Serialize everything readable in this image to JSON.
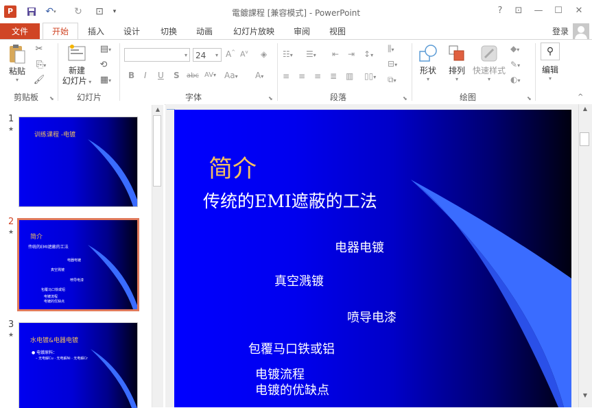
{
  "window": {
    "title": "電鍍課程 [兼容模式] - PowerPoint",
    "help_icon": "?",
    "colors": {
      "accent": "#d04525",
      "slide_blue": "#0000ff",
      "slide_title": "#f5c060"
    }
  },
  "tabs": {
    "file": "文件",
    "items": [
      "开始",
      "插入",
      "设计",
      "切换",
      "动画",
      "幻灯片放映",
      "审阅",
      "视图"
    ],
    "active": "开始",
    "signin": "登录"
  },
  "ribbon": {
    "clipboard": {
      "paste": "粘贴",
      "group": "剪贴板"
    },
    "slides": {
      "new_slide_line1": "新建",
      "new_slide_line2": "幻灯片",
      "group": "幻灯片"
    },
    "font": {
      "font_name": "",
      "font_size": "24",
      "group": "字体"
    },
    "paragraph": {
      "group": "段落"
    },
    "drawing": {
      "shape": "形状",
      "arrange": "排列",
      "quick_styles": "快速样式",
      "group": "绘图"
    },
    "editing": {
      "edit": "编辑"
    }
  },
  "slides": [
    {
      "number": "1",
      "title": "训练课程 -电镀",
      "lines": []
    },
    {
      "number": "2",
      "title": "简介",
      "lines": [
        "传统的EMI遮蔽的工法",
        "电器电镀",
        "真空溅镀",
        "喷导电漆",
        "包覆马口铁或铝",
        "电镀流程",
        "电镀的优缺点"
      ]
    },
    {
      "number": "3",
      "title": "水电镀&电器电镀",
      "lines": [
        "● 电镀原料：",
        "– 无电解Cu · 无电解Ni · 无电解Cr"
      ]
    }
  ],
  "selected_slide": 2,
  "current_slide": {
    "title": "简介",
    "subtitle": "传统的EMI遮蔽的工法",
    "items": [
      "电器电镀",
      "真空溅镀",
      "喷导电漆",
      "包覆马口铁或铝",
      "电镀流程",
      "电镀的优缺点"
    ]
  }
}
